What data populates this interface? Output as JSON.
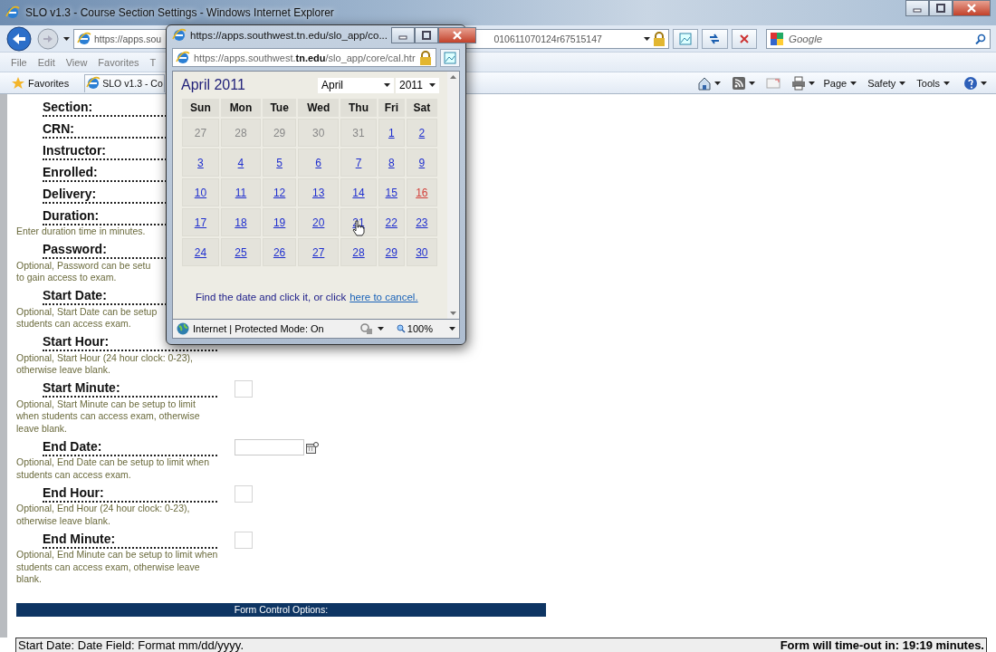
{
  "window": {
    "title": "SLO v1.3 - Course Section Settings - Windows Internet Explorer"
  },
  "address_bar": {
    "url_start": "https://apps.sou",
    "url_end": "010611070124r67515147"
  },
  "search": {
    "placeholder": "Google"
  },
  "menu": [
    "File",
    "Edit",
    "View",
    "Favorites",
    "T"
  ],
  "favorites": {
    "label": "Favorites",
    "tab": "SLO v1.3 - Co"
  },
  "command_bar": [
    {
      "kind": "home"
    },
    {
      "kind": "feed"
    },
    {
      "kind": "mail"
    },
    {
      "kind": "print"
    },
    {
      "kind": "text",
      "label": "Page"
    },
    {
      "kind": "text",
      "label": "Safety"
    },
    {
      "kind": "text",
      "label": "Tools"
    },
    {
      "kind": "help"
    }
  ],
  "form": {
    "fields": [
      {
        "label": "Section:",
        "kind": "plain"
      },
      {
        "label": "CRN:",
        "kind": "plain"
      },
      {
        "label": "Instructor:",
        "kind": "plain"
      },
      {
        "label": "Enrolled:",
        "kind": "plain"
      },
      {
        "label": "Delivery:",
        "kind": "plain"
      },
      {
        "label": "Duration:",
        "kind": "plain",
        "note": [
          "Enter duration time in minutes."
        ]
      },
      {
        "label": "Password:",
        "kind": "plain",
        "note": [
          "Optional, Password can be setu",
          "to gain access to exam."
        ]
      },
      {
        "label": "Start Date:",
        "kind": "plain",
        "note": [
          "Optional, Start Date can be setup",
          "students can access exam."
        ]
      },
      {
        "label": "Start Hour:",
        "kind": "plain",
        "note": [
          "Optional, Start Hour (24 hour clock: 0-23),",
          "otherwise leave blank."
        ]
      },
      {
        "label": "Start Minute:",
        "kind": "small",
        "note": [
          "Optional, Start Minute can be setup to limit",
          "when students can access exam, otherwise",
          "leave blank."
        ]
      },
      {
        "label": "End Date:",
        "kind": "date",
        "note": [
          "Optional, End Date can be setup to limit when",
          "students can access exam."
        ]
      },
      {
        "label": "End Hour:",
        "kind": "small",
        "note": [
          "Optional, End Hour (24 hour clock: 0-23),",
          "otherwise leave blank."
        ]
      },
      {
        "label": "End Minute:",
        "kind": "small",
        "note": [
          "Optional, End Minute can be setup to limit when",
          "students can access exam, otherwise leave",
          "blank."
        ]
      }
    ],
    "options_bar": "Form Control Options:"
  },
  "status_bar": {
    "hint": "Start Date: Date Field: Format mm/dd/yyyy.",
    "timeout": "Form will time-out in: 19:19 minutes."
  },
  "popup": {
    "title": "https://apps.southwest.tn.edu/slo_app/co...",
    "url": "https://apps.southwest.**tn.edu**/slo_app/core/cal.htr",
    "heading": "April 2011",
    "month_select": "April",
    "year_select": "2011",
    "weekdays": [
      "Sun",
      "Mon",
      "Tue",
      "Wed",
      "Thu",
      "Fri",
      "Sat"
    ],
    "weeks": [
      [
        {
          "day": "27",
          "kind": "muted"
        },
        {
          "day": "28",
          "kind": "muted"
        },
        {
          "day": "29",
          "kind": "muted"
        },
        {
          "day": "30",
          "kind": "muted"
        },
        {
          "day": "31",
          "kind": "muted"
        },
        {
          "day": "1",
          "kind": "link"
        },
        {
          "day": "2",
          "kind": "link"
        }
      ],
      [
        {
          "day": "3",
          "kind": "link"
        },
        {
          "day": "4",
          "kind": "link"
        },
        {
          "day": "5",
          "kind": "link"
        },
        {
          "day": "6",
          "kind": "link"
        },
        {
          "day": "7",
          "kind": "link"
        },
        {
          "day": "8",
          "kind": "link"
        },
        {
          "day": "9",
          "kind": "link"
        }
      ],
      [
        {
          "day": "10",
          "kind": "link"
        },
        {
          "day": "11",
          "kind": "link"
        },
        {
          "day": "12",
          "kind": "link"
        },
        {
          "day": "13",
          "kind": "link"
        },
        {
          "day": "14",
          "kind": "link"
        },
        {
          "day": "15",
          "kind": "link"
        },
        {
          "day": "16",
          "kind": "today"
        }
      ],
      [
        {
          "day": "17",
          "kind": "link"
        },
        {
          "day": "18",
          "kind": "link"
        },
        {
          "day": "19",
          "kind": "link"
        },
        {
          "day": "20",
          "kind": "link"
        },
        {
          "day": "21",
          "kind": "link"
        },
        {
          "day": "22",
          "kind": "link"
        },
        {
          "day": "23",
          "kind": "link"
        }
      ],
      [
        {
          "day": "24",
          "kind": "link"
        },
        {
          "day": "25",
          "kind": "link"
        },
        {
          "day": "26",
          "kind": "link"
        },
        {
          "day": "27",
          "kind": "link"
        },
        {
          "day": "28",
          "kind": "link"
        },
        {
          "day": "29",
          "kind": "link"
        },
        {
          "day": "30",
          "kind": "link"
        }
      ]
    ],
    "footer": "Find the date and click it, or click",
    "cancel_link": "here to cancel.",
    "status": "Internet | Protected Mode: On",
    "zoom": "100%"
  }
}
